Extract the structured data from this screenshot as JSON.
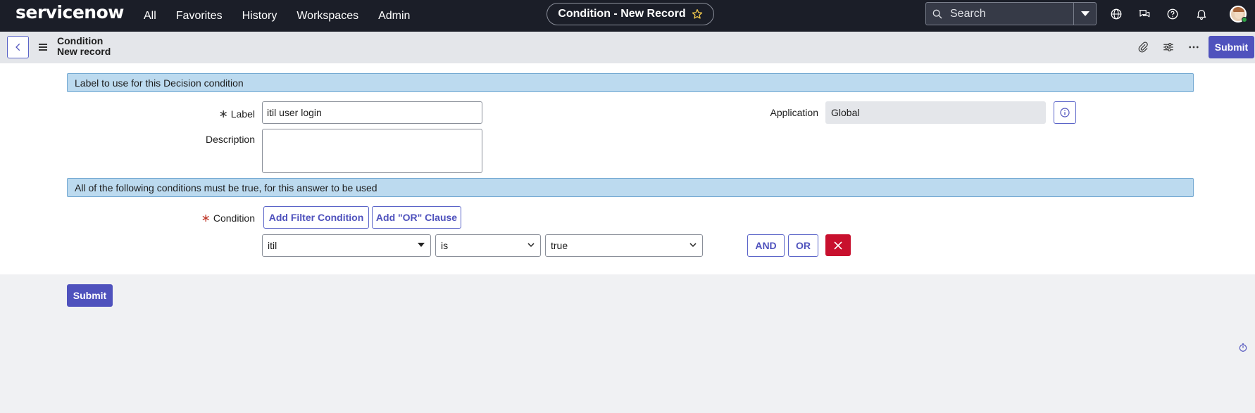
{
  "topnav": {
    "logo": "servicenow",
    "links": [
      "All",
      "Favorites",
      "History",
      "Workspaces",
      "Admin"
    ],
    "record_title": "Condition - New Record",
    "search_placeholder": "Search",
    "icons": [
      "search-icon",
      "globe-icon",
      "chat-icon",
      "help-icon",
      "bell-icon"
    ]
  },
  "subheader": {
    "crumb_line1": "Condition",
    "crumb_line2": "New record",
    "submit_label": "Submit",
    "icons": [
      "attachment-icon",
      "settings-sliders-icon",
      "more-icon"
    ]
  },
  "form": {
    "section1_title": "Label to use for this Decision condition",
    "label_field": {
      "label": "Label",
      "required_mark": "∗",
      "value": "itil user login"
    },
    "description_field": {
      "label": "Description",
      "value": ""
    },
    "application_field": {
      "label": "Application",
      "value": "Global"
    },
    "section2_title": "All of the following conditions must be true, for this answer to be used",
    "condition": {
      "label": "Condition",
      "required_mark": "∗",
      "add_filter_label": "Add Filter Condition",
      "add_or_label": "Add \"OR\" Clause",
      "field_value": "itil",
      "operator_value": "is",
      "value_value": "true",
      "and_label": "AND",
      "or_label": "OR"
    }
  },
  "footer": {
    "submit_label": "Submit"
  },
  "colors": {
    "nav_bg": "#1b1e28",
    "primary": "#4f52bd",
    "section_bg": "#bcdaef",
    "danger": "#c8102e",
    "required": "#c0392b"
  }
}
